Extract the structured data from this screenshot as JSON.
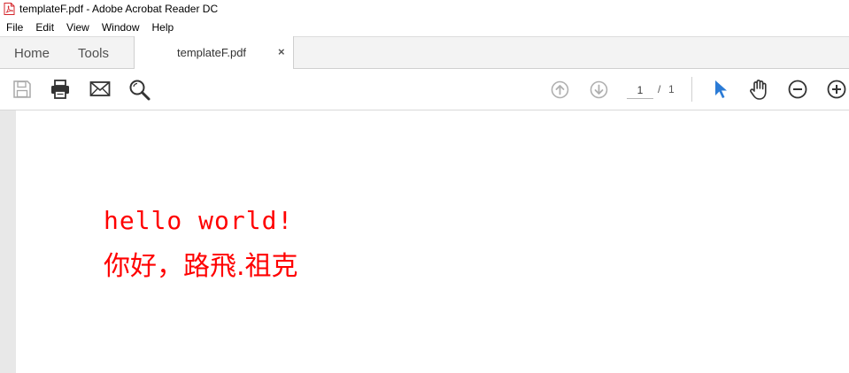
{
  "window": {
    "title": "templateF.pdf - Adobe Acrobat Reader DC"
  },
  "menu": [
    "File",
    "Edit",
    "View",
    "Window",
    "Help"
  ],
  "tabs": {
    "home": "Home",
    "tools": "Tools",
    "document": "templateF.pdf",
    "close": "×"
  },
  "toolbar": {
    "current_page": "1",
    "separator": "/",
    "total_pages": "1",
    "icons": [
      "save-icon",
      "print-icon",
      "email-icon",
      "find-icon",
      "previous-page-icon",
      "next-page-icon",
      "select-tool-icon",
      "hand-tool-icon",
      "zoom-out-icon",
      "zoom-in-icon"
    ]
  },
  "document": {
    "line1": "hello world!",
    "line2": "你好，路飛.祖克",
    "text_color": "#ff0000"
  },
  "colors": {
    "accent_blue": "#2b7bd6",
    "pdf_icon_red": "#d4252b"
  }
}
